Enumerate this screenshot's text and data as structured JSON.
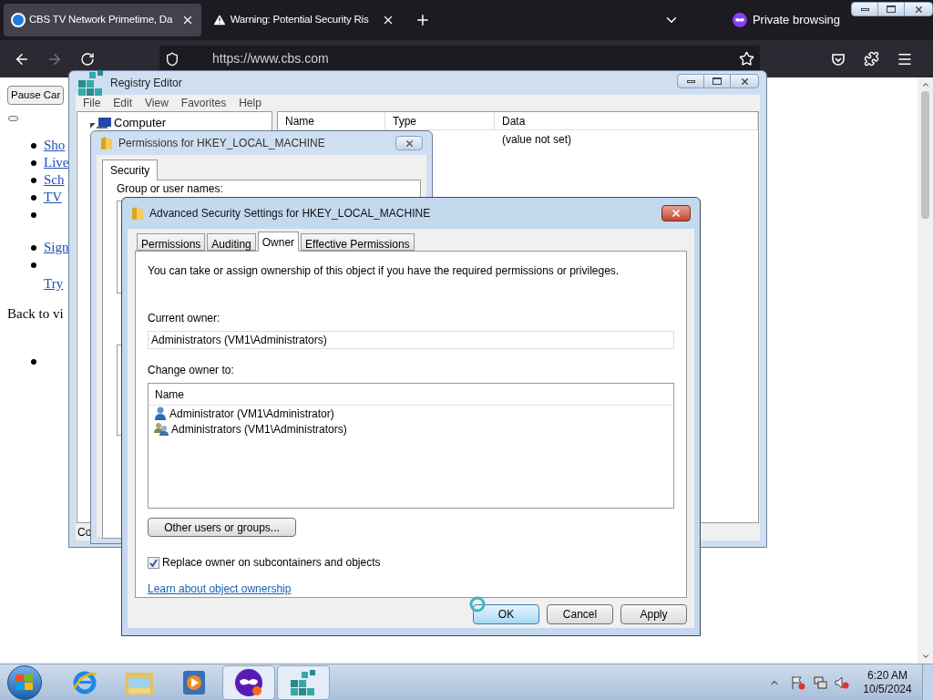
{
  "browser": {
    "tabs": [
      {
        "title": "CBS TV Network Primetime, Da",
        "kind": "site",
        "selected": true
      },
      {
        "title": "Warning: Potential Security Ris",
        "kind": "warning",
        "selected": false
      }
    ],
    "private_label": "Private browsing",
    "url": "https://www.cbs.com"
  },
  "page": {
    "button": "Pause Car",
    "links": [
      "Sho",
      "Live",
      "Sch",
      "TV"
    ],
    "links2": [
      "Sign"
    ],
    "try_link": "Try",
    "back_text": "Back to vi"
  },
  "regedit": {
    "title": "Registry Editor",
    "menu": [
      "File",
      "Edit",
      "View",
      "Favorites",
      "Help"
    ],
    "tree": [
      {
        "label": "Computer",
        "expanded": true
      }
    ],
    "columns": [
      "Name",
      "Type",
      "Data"
    ],
    "value_data": "(value not set)",
    "status": "Co"
  },
  "permissions": {
    "title": "Permissions for HKEY_LOCAL_MACHINE",
    "tab": "Security",
    "group_label": "Group or user names:"
  },
  "advanced": {
    "title": "Advanced Security Settings for HKEY_LOCAL_MACHINE",
    "tabs": [
      {
        "label": "Permissions",
        "selected": false
      },
      {
        "label": "Auditing",
        "selected": false
      },
      {
        "label": "Owner",
        "selected": true
      },
      {
        "label": "Effective Permissions",
        "selected": false
      }
    ],
    "description": "You can take or assign ownership of this object if you have the required permissions or privileges.",
    "current_owner_label": "Current owner:",
    "current_owner": "Administrators (VM1\\Administrators)",
    "change_label": "Change owner to:",
    "list_column": "Name",
    "entries": [
      {
        "name": "Administrator (VM1\\Administrator)",
        "kind": "user",
        "selected": false
      },
      {
        "name": "Administrators (VM1\\Administrators)",
        "kind": "group",
        "selected": false
      }
    ],
    "other_button": "Other users or groups...",
    "checkbox": {
      "label": "Replace owner on subcontainers and objects",
      "checked": true
    },
    "link": "Learn about object ownership",
    "buttons": [
      {
        "label": "OK",
        "default": true
      },
      {
        "label": "Cancel",
        "default": false
      },
      {
        "label": "Apply",
        "default": false
      }
    ]
  },
  "taskbar": {
    "apps": [
      {
        "kind": "ie",
        "running": false
      },
      {
        "kind": "explorer",
        "running": false
      },
      {
        "kind": "media",
        "running": false
      },
      {
        "kind": "private",
        "running": true
      },
      {
        "kind": "regedit",
        "running": true
      }
    ],
    "time": "6:20 AM",
    "date": "10/5/2024"
  }
}
